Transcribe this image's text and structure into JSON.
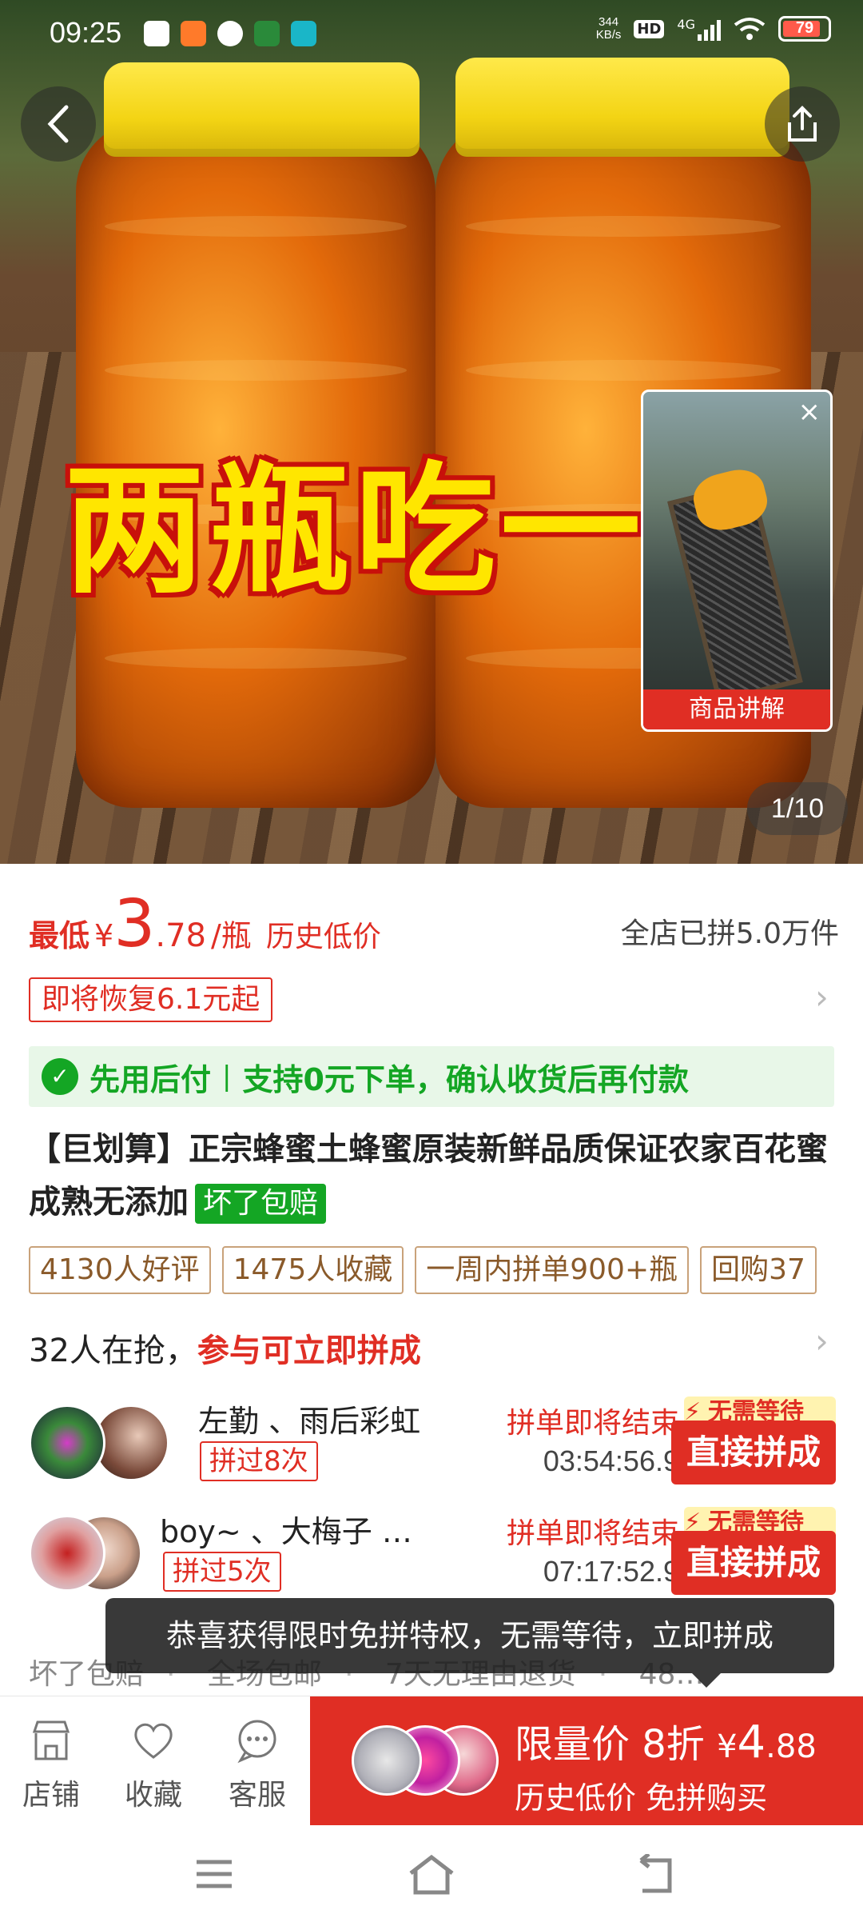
{
  "status_bar": {
    "time": "09:25",
    "net_speed_value": "344",
    "net_speed_unit": "KB/s",
    "hd_label": "HD",
    "network_label": "4G",
    "battery_level": "79"
  },
  "hero": {
    "overlay_text": "两瓶吃一",
    "pager": "1/10",
    "live_card_caption": "商品讲解",
    "live_card_close": "×"
  },
  "price": {
    "label": "最低",
    "currency": "¥",
    "integer": "3",
    "decimal": ".78",
    "unit": "/瓶",
    "history_label": "历史低价",
    "sold_text": "全店已拼5.0万件",
    "restore_notice": "即将恢复6.1元起"
  },
  "pay_banner": {
    "main": "先用后付",
    "separator": "|",
    "detail": "支持0元下单，确认收货后再付款"
  },
  "product": {
    "title": "【巨划算】正宗蜂蜜土蜂蜜原装新鲜品质保证农家百花蜜成熟无添加",
    "badge": "坏了包赔"
  },
  "tags": [
    "4130人好评",
    "1475人收藏",
    "一周内拼单900+瓶",
    "回购37"
  ],
  "group_buy": {
    "count_text": "32人在抢，",
    "highlight": "参与可立即拼成",
    "rows": [
      {
        "names": "左勤 、雨后彩虹",
        "times": "拼过8次",
        "ending_label": "拼单即将结束",
        "timer": "03:54:56.9",
        "tip": "无需等待",
        "button": "直接拼成"
      },
      {
        "names": "boy~ 、大梅子 …",
        "times": "拼过5次",
        "ending_label": "拼单即将结束",
        "timer": "07:17:52.9",
        "tip": "无需等待",
        "button": "直接拼成"
      }
    ]
  },
  "toast": "恭喜获得限时免拼特权，无需等待，立即拼成",
  "services": [
    "坏了包赔",
    "全场包邮",
    "7天无理由退货",
    "48…"
  ],
  "bottom_bar": {
    "store": "店铺",
    "favorite": "收藏",
    "service": "客服",
    "buy_line1_label": "限量价 8折",
    "buy_currency": "¥",
    "buy_price_int": "4",
    "buy_price_dec": ".88",
    "buy_line2": "历史低价 免拼购买"
  },
  "colors": {
    "accent_red": "#e02e24",
    "green": "#14a624",
    "honey": "#e36a0a",
    "cap_yellow": "#f3d414"
  }
}
